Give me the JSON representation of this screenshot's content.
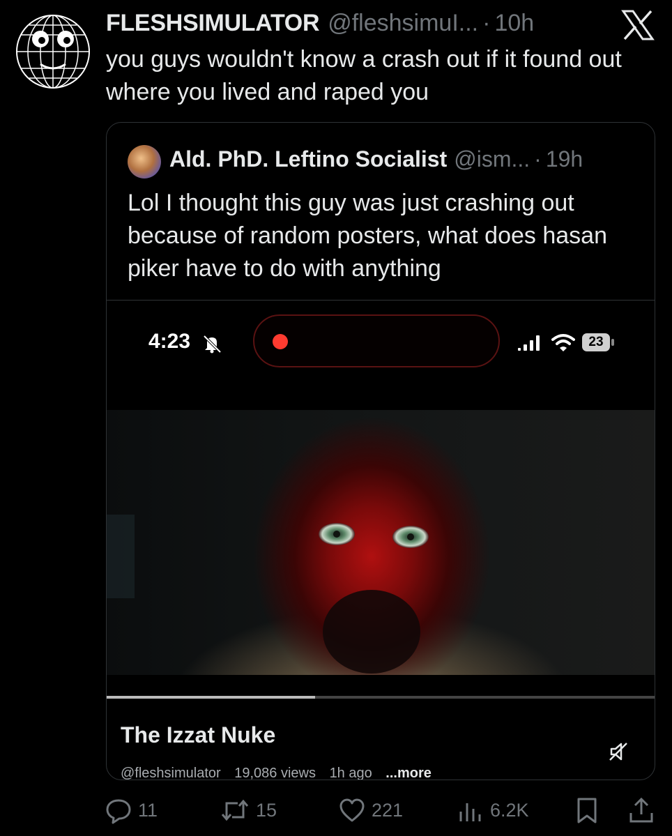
{
  "tweet": {
    "display_name": "FLESHSIMULATOR",
    "handle": "@fleshsimuI...",
    "separator": "·",
    "time": "10h",
    "text": "you guys wouldn't know a crash out if it found out where you lived and raped you"
  },
  "quote": {
    "display_name": "Ald. PhD. Leftino Socialist",
    "handle": "@ism...",
    "separator": "·",
    "time": "19h",
    "text": "Lol I thought this guy was just crashing out because of random posters, what does hasan piker have to do with anything",
    "video": {
      "status_time": "4:23",
      "battery": "23",
      "progress": 0.38,
      "title": "The Izzat Nuke",
      "channel": "@fleshsimulator",
      "views": "19,086 views",
      "age": "1h ago",
      "more": "...more"
    }
  },
  "actions": {
    "replies": "11",
    "reposts": "15",
    "likes": "221",
    "views": "6.2K"
  },
  "icons": [
    "globe-face-avatar",
    "x-logo-icon",
    "bell-slash-icon",
    "record-dot-icon",
    "signal-icon",
    "wifi-icon",
    "battery-icon",
    "mute-icon",
    "reply-icon",
    "repost-icon",
    "like-icon",
    "views-icon",
    "bookmark-icon",
    "share-icon"
  ],
  "colors": {
    "background": "#000000",
    "text": "#e7e9ea",
    "muted": "#71767b",
    "border": "#2f3336",
    "record": "#ff3b30"
  }
}
